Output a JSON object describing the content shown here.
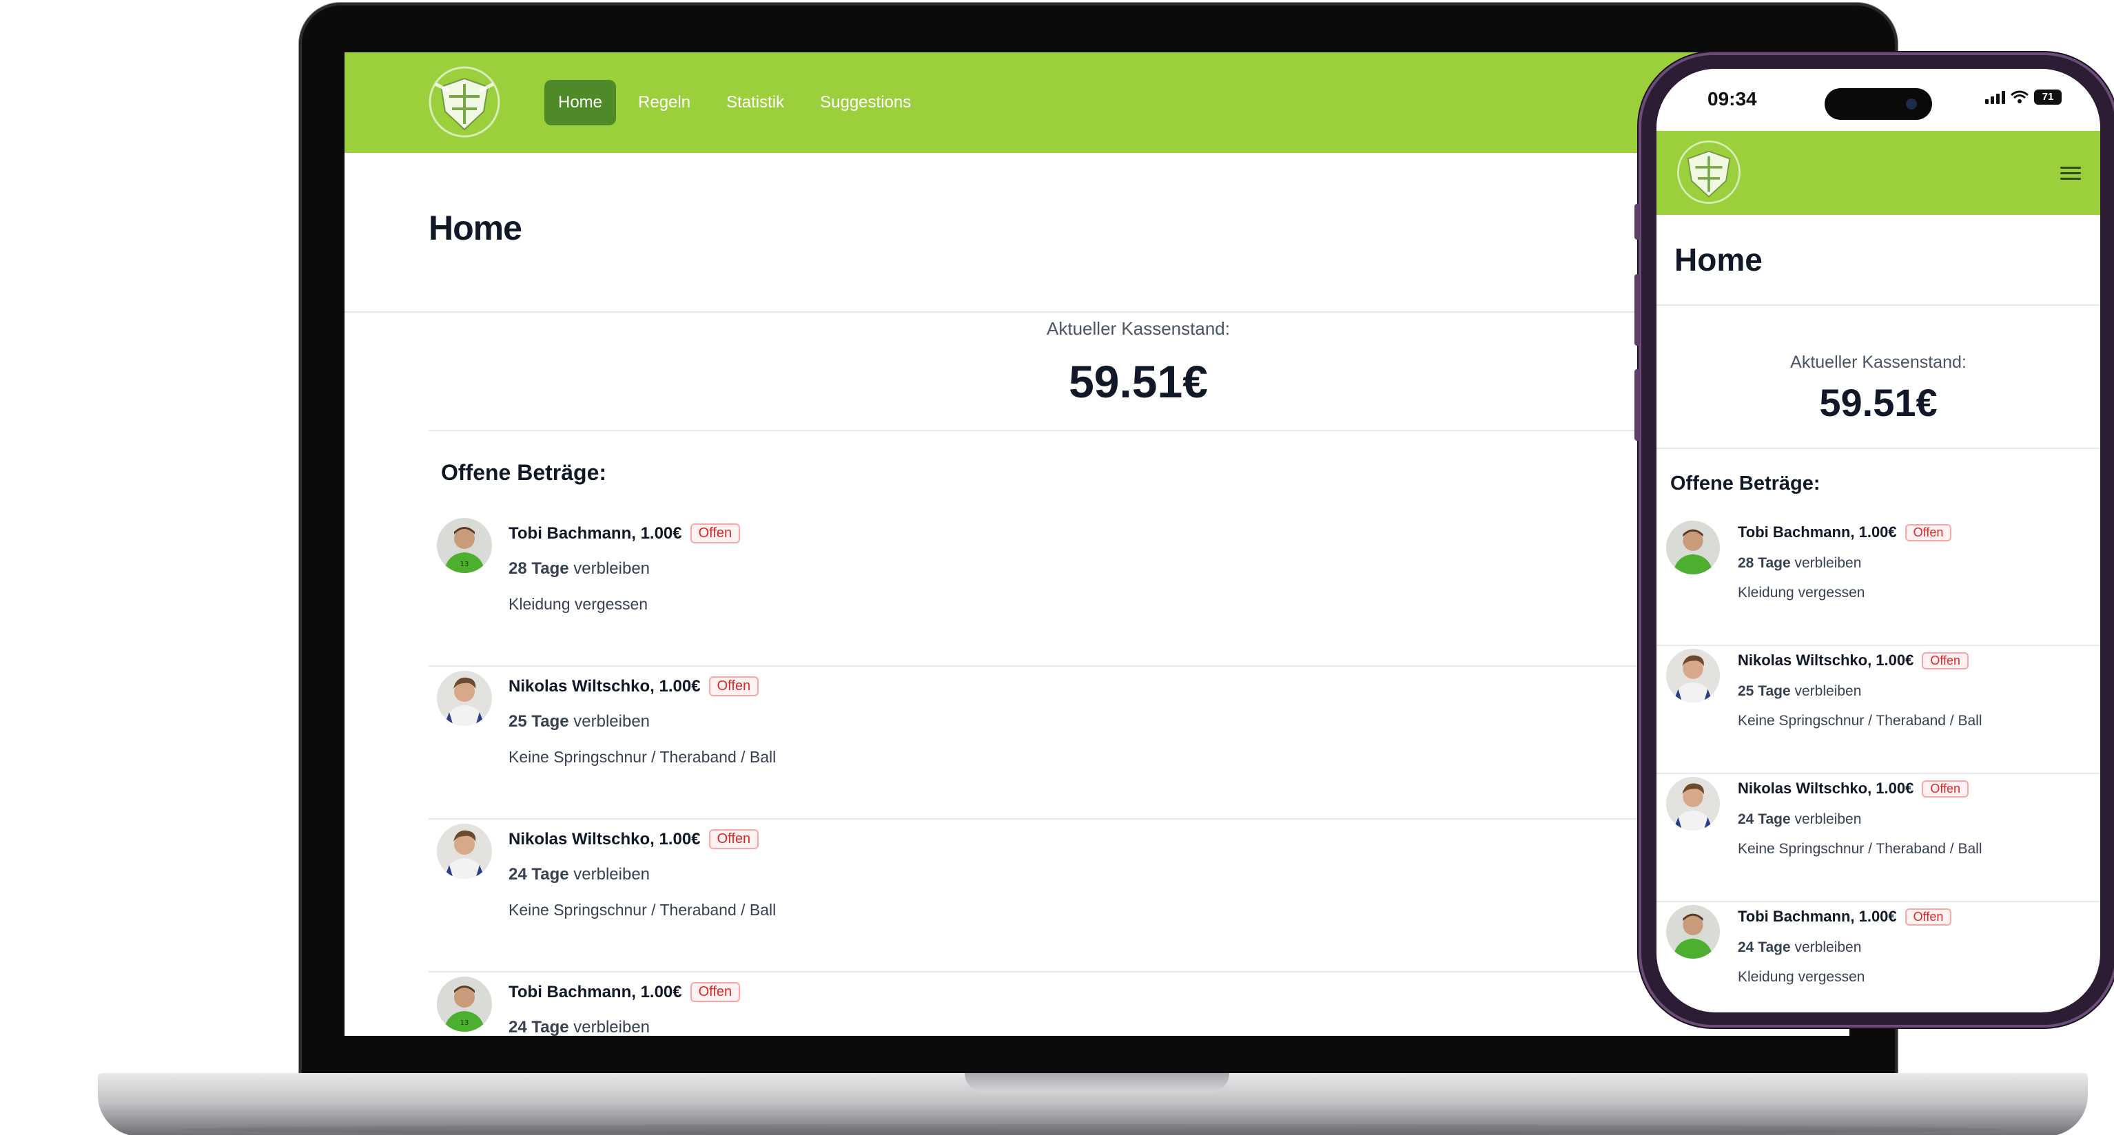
{
  "app": {
    "nav_items": [
      {
        "label": "Home",
        "active": true
      },
      {
        "label": "Regeln",
        "active": false
      },
      {
        "label": "Statistik",
        "active": false
      },
      {
        "label": "Suggestions",
        "active": false
      }
    ],
    "page_title": "Home",
    "balance_label": "Aktueller Kassenstand:",
    "balance_value": "59.51€",
    "section_title": "Offene Beträge:",
    "status_badge": "Offen",
    "days_suffix": "verbleiben"
  },
  "desktop_entries": [
    {
      "name_amount": "Tobi Bachmann, 1.00€",
      "days": "28 Tage",
      "reason": "Kleidung vergessen",
      "avatar": "green-jersey-avatar"
    },
    {
      "name_amount": "Nikolas Wiltschko, 1.00€",
      "days": "25 Tage",
      "reason": "Keine Springschnur / Theraband / Ball",
      "avatar": "white-jersey-avatar"
    },
    {
      "name_amount": "Nikolas Wiltschko, 1.00€",
      "days": "24 Tage",
      "reason": "Keine Springschnur / Theraband / Ball",
      "avatar": "white-jersey-avatar"
    },
    {
      "name_amount": "Tobi Bachmann, 1.00€",
      "days": "24 Tage",
      "reason": "",
      "avatar": "green-jersey-avatar"
    }
  ],
  "mobile_entries": [
    {
      "name_amount": "Tobi Bachmann, 1.00€",
      "days": "28 Tage",
      "reason": "Kleidung vergessen",
      "avatar": "green-jersey-avatar"
    },
    {
      "name_amount": "Nikolas Wiltschko, 1.00€",
      "days": "25 Tage",
      "reason": "Keine Springschnur / Theraband / Ball",
      "avatar": "white-jersey-avatar"
    },
    {
      "name_amount": "Nikolas Wiltschko, 1.00€",
      "days": "24 Tage",
      "reason": "Keine Springschnur / Theraband / Ball",
      "avatar": "white-jersey-avatar"
    },
    {
      "name_amount": "Tobi Bachmann, 1.00€",
      "days": "24 Tage",
      "reason": "Kleidung vergessen",
      "avatar": "green-jersey-avatar"
    }
  ],
  "phone_status": {
    "time": "09:34",
    "battery": "71"
  },
  "colors": {
    "navbar": "#9ccf3c",
    "active_nav": "#4e8a28",
    "badge_text": "#dc2626",
    "badge_border": "#fca5a5",
    "phone_frame": "#2c1d34"
  }
}
